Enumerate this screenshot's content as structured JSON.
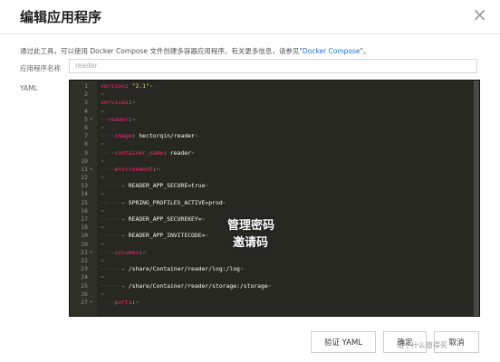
{
  "dialog": {
    "title": "编辑应用程序",
    "close_glyph": "×",
    "intro_text": "通过此工具，可以使用 Docker Compose 文件创建多容器应用程序。有关更多信息，请参见\"",
    "intro_link": "Docker Compose",
    "intro_end": "\"。",
    "name_label": "应用程序名称",
    "name_value": "reader",
    "yaml_label": "YAML"
  },
  "yaml_lines": [
    {
      "n": "1",
      "fold": "",
      "parts": [
        [
          "k",
          "version"
        ],
        [
          "v",
          ": "
        ],
        [
          "s",
          "\"2.1\""
        ],
        [
          "pil",
          "¤"
        ]
      ]
    },
    {
      "n": "2",
      "fold": "",
      "parts": [
        [
          "pil",
          "¤"
        ]
      ]
    },
    {
      "n": "3",
      "fold": "",
      "parts": [
        [
          "k",
          "services"
        ],
        [
          "v",
          ":"
        ],
        [
          "pil",
          "¤"
        ]
      ]
    },
    {
      "n": "4",
      "fold": "",
      "parts": [
        [
          "pil",
          "¤"
        ]
      ]
    },
    {
      "n": "5",
      "fold": "▾",
      "parts": [
        [
          "dots",
          "··"
        ],
        [
          "k",
          "reader"
        ],
        [
          "v",
          ":"
        ],
        [
          "pil",
          "¤"
        ]
      ]
    },
    {
      "n": "6",
      "fold": "",
      "parts": [
        [
          "pil",
          "¤"
        ]
      ]
    },
    {
      "n": "7",
      "fold": "",
      "parts": [
        [
          "dots",
          "····"
        ],
        [
          "k",
          "image"
        ],
        [
          "v",
          ": hectorqin/reader"
        ],
        [
          "pil",
          "¤"
        ]
      ]
    },
    {
      "n": "8",
      "fold": "",
      "parts": [
        [
          "pil",
          "¤"
        ]
      ]
    },
    {
      "n": "9",
      "fold": "",
      "parts": [
        [
          "dots",
          "····"
        ],
        [
          "k",
          "container_name"
        ],
        [
          "v",
          ": reader"
        ],
        [
          "pil",
          "¤"
        ]
      ]
    },
    {
      "n": "10",
      "fold": "",
      "parts": [
        [
          "pil",
          "¤"
        ]
      ]
    },
    {
      "n": "11",
      "fold": "▾",
      "parts": [
        [
          "dots",
          "····"
        ],
        [
          "k",
          "environment"
        ],
        [
          "v",
          ":"
        ],
        [
          "pil",
          "¤"
        ]
      ]
    },
    {
      "n": "12",
      "fold": "",
      "parts": [
        [
          "pil",
          "¤"
        ]
      ]
    },
    {
      "n": "13",
      "fold": "",
      "parts": [
        [
          "dots",
          "······"
        ],
        [
          "v",
          "- READER_APP_SECURE=true"
        ],
        [
          "pil",
          "¤"
        ]
      ]
    },
    {
      "n": "14",
      "fold": "",
      "parts": [
        [
          "pil",
          "¤"
        ]
      ]
    },
    {
      "n": "15",
      "fold": "",
      "parts": [
        [
          "dots",
          "······"
        ],
        [
          "v",
          "- SPRING_PROFILES_ACTIVE=prod"
        ],
        [
          "pil",
          "¤"
        ]
      ]
    },
    {
      "n": "16",
      "fold": "",
      "parts": [
        [
          "pil",
          "¤"
        ]
      ]
    },
    {
      "n": "17",
      "fold": "",
      "parts": [
        [
          "dots",
          "······"
        ],
        [
          "v",
          "- READER_APP_SECUREKEY="
        ],
        [
          "pil",
          "¤"
        ]
      ]
    },
    {
      "n": "18",
      "fold": "",
      "parts": [
        [
          "pil",
          "¤"
        ]
      ]
    },
    {
      "n": "19",
      "fold": "",
      "parts": [
        [
          "dots",
          "······"
        ],
        [
          "v",
          "- READER_APP_INVITECODE="
        ],
        [
          "pil",
          "¤"
        ]
      ]
    },
    {
      "n": "20",
      "fold": "",
      "parts": [
        [
          "pil",
          "¤"
        ]
      ]
    },
    {
      "n": "21",
      "fold": "▾",
      "parts": [
        [
          "dots",
          "····"
        ],
        [
          "k",
          "volumes"
        ],
        [
          "v",
          ":"
        ],
        [
          "pil",
          "¤"
        ]
      ]
    },
    {
      "n": "22",
      "fold": "",
      "parts": [
        [
          "pil",
          "¤"
        ]
      ]
    },
    {
      "n": "23",
      "fold": "",
      "parts": [
        [
          "dots",
          "······"
        ],
        [
          "v",
          "- /share/Container/reader/log:/log"
        ],
        [
          "pil",
          "¤"
        ]
      ]
    },
    {
      "n": "24",
      "fold": "",
      "parts": [
        [
          "pil",
          "¤"
        ]
      ]
    },
    {
      "n": "25",
      "fold": "",
      "parts": [
        [
          "dots",
          "······"
        ],
        [
          "v",
          "- /share/Container/reader/storage:/storage"
        ],
        [
          "pil",
          "¤"
        ]
      ]
    },
    {
      "n": "26",
      "fold": "",
      "parts": [
        [
          "pil",
          "¤"
        ]
      ]
    },
    {
      "n": "27",
      "fold": "▾",
      "parts": [
        [
          "dots",
          "····"
        ],
        [
          "k",
          "ports"
        ],
        [
          "v",
          ":"
        ],
        [
          "pil",
          "¤"
        ]
      ]
    }
  ],
  "annotations": {
    "securekey_note": "管理密码",
    "invitecode_note": "邀请码"
  },
  "buttons": {
    "validate": "验证 YAML",
    "ok": "确定",
    "cancel": "取消"
  },
  "watermark": "值 | 什么值得买"
}
